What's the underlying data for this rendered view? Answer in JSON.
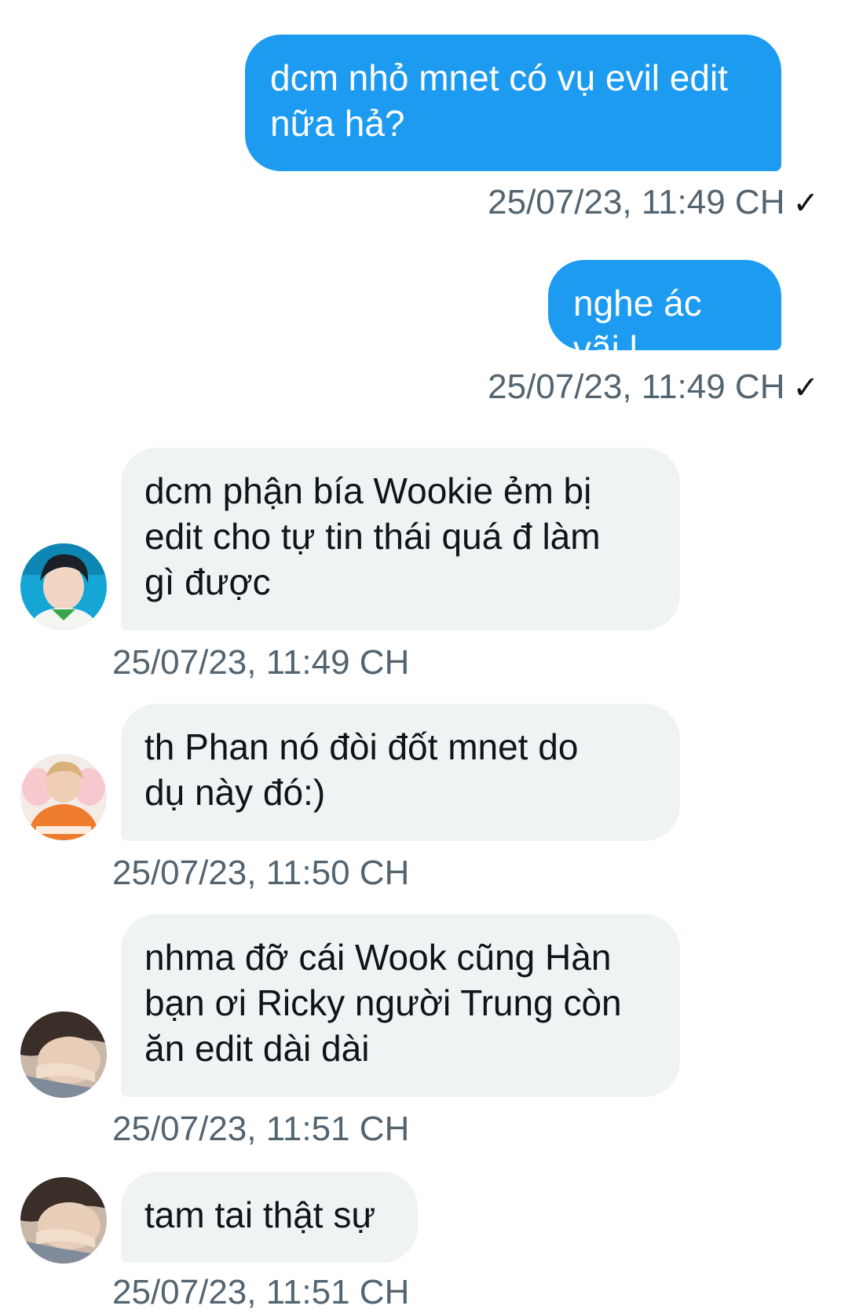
{
  "messages": [
    {
      "direction": "sent",
      "text": "dcm nhỏ mnet có vụ evil edit\nnữa hả?",
      "time": "25/07/23, 11:49 CH",
      "read_mark": "✓"
    },
    {
      "direction": "sent",
      "text": "nghe ác vãi l",
      "time": "25/07/23, 11:49 CH",
      "read_mark": "✓"
    },
    {
      "direction": "received",
      "avatar": "avatar-blue-background-person",
      "text": "dcm phận bía Wookie ẻm bị\nedit cho tự tin thái quá đ làm\ngì được",
      "time": "25/07/23, 11:49 CH"
    },
    {
      "direction": "received",
      "avatar": "avatar-orange-outfit-person",
      "text": "th Phan nó đòi đốt mnet do\ndụ này đó:)",
      "time": "25/07/23, 11:50 CH"
    },
    {
      "direction": "received",
      "avatar": "avatar-closeup-face",
      "text": "nhma đỡ cái Wook cũng Hàn\nbạn ơi Ricky người Trung còn\năn edit dài dài",
      "time": "25/07/23, 11:51 CH"
    },
    {
      "direction": "received",
      "avatar": "avatar-closeup-face",
      "text": "tam tai thật sự",
      "time": "25/07/23, 11:51 CH"
    }
  ],
  "colors": {
    "sent_bubble": "#1d9bf0",
    "received_bubble": "#eff3f4",
    "timestamp": "#536471"
  }
}
